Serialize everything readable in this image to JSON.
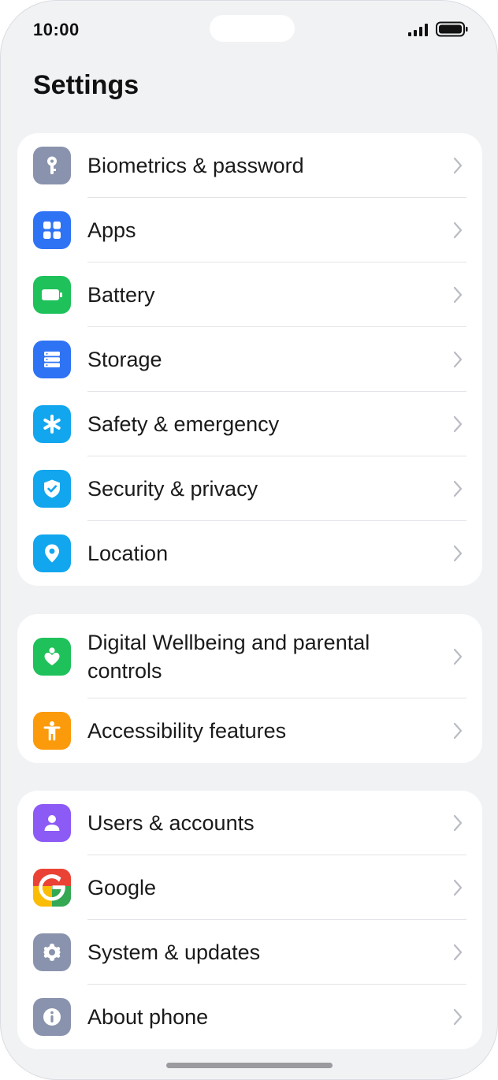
{
  "status_bar": {
    "time": "10:00"
  },
  "header": {
    "title": "Settings"
  },
  "groups": [
    {
      "items": [
        {
          "label": "Biometrics & password",
          "icon": "key-icon",
          "color": "#8a93ad"
        },
        {
          "label": "Apps",
          "icon": "apps-grid-icon",
          "color": "#2f73f5"
        },
        {
          "label": "Battery",
          "icon": "battery-icon",
          "color": "#1fc15a"
        },
        {
          "label": "Storage",
          "icon": "storage-icon",
          "color": "#2f73f5"
        },
        {
          "label": "Safety & emergency",
          "icon": "asterisk-icon",
          "color": "#12a6ee"
        },
        {
          "label": "Security & privacy",
          "icon": "shield-check-icon",
          "color": "#12a6ee"
        },
        {
          "label": "Location",
          "icon": "location-pin-icon",
          "color": "#12a6ee"
        }
      ]
    },
    {
      "items": [
        {
          "label": "Digital Wellbeing and parental controls",
          "icon": "heart-person-icon",
          "color": "#1fc15a"
        },
        {
          "label": "Accessibility features",
          "icon": "accessibility-icon",
          "color": "#fb9a0b"
        }
      ]
    },
    {
      "items": [
        {
          "label": "Users & accounts",
          "icon": "user-icon",
          "color": "#8c5af5"
        },
        {
          "label": "Google",
          "icon": "google-icon",
          "color": "#ea4335"
        },
        {
          "label": "System & updates",
          "icon": "gear-icon",
          "color": "#8a93ad"
        },
        {
          "label": "About phone",
          "icon": "info-icon",
          "color": "#8a93ad"
        }
      ]
    }
  ]
}
